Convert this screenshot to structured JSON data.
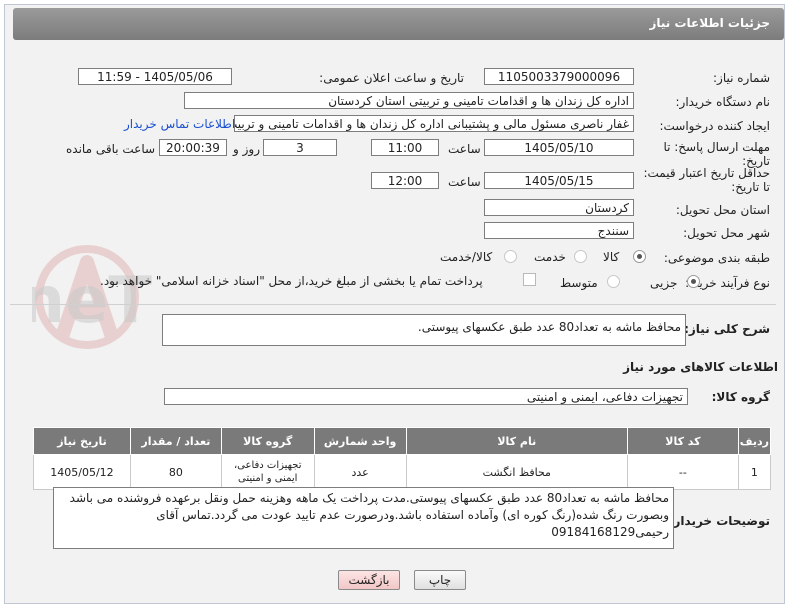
{
  "header": {
    "title": "جزئیات اطلاعات نیاز"
  },
  "form": {
    "need_number_label": "شماره نیاز:",
    "need_number": "1105003379000096",
    "announce_label": "تاریخ و ساعت اعلان عمومی:",
    "announce_value": "1405/05/06 - 11:59",
    "buyer_org_label": "نام دستگاه خریدار:",
    "buyer_org": "اداره کل زندان ها و اقدامات تامینی و تربیتی استان کردستان",
    "creator_label": "ایجاد کننده درخواست:",
    "creator": "غفار ناصری مسئول مالی و پشتیبانی اداره کل زندان ها و اقدامات تامینی و تربیت",
    "contact_link": "اطلاعات تماس خریدار",
    "deadline_label": "مهلت ارسال پاسخ: تا تاریخ:",
    "deadline_date": "1405/05/10",
    "deadline_time_label": "ساعت",
    "deadline_time": "11:00",
    "days_value": "3",
    "days_label": "روز و",
    "remaining_time": "20:00:39",
    "remaining_label": "ساعت باقی مانده",
    "validity_label": "حداقل تاریخ اعتبار قیمت: تا تاریخ:",
    "validity_date": "1405/05/15",
    "validity_time_label": "ساعت",
    "validity_time": "12:00",
    "province_label": "استان محل تحویل:",
    "province": "کردستان",
    "city_label": "شهر محل تحویل:",
    "city": "سنندج",
    "category_label": "طبقه بندی موضوعی:",
    "category_options": [
      "کالا",
      "خدمت",
      "کالا/خدمت"
    ],
    "process_label": "نوع فرآیند خرید :",
    "process_options": [
      "جزیی",
      "متوسط"
    ],
    "payment_note": "پرداخت تمام یا بخشی از مبلغ خرید،از محل \"اسناد خزانه اسلامی\" خواهد بود."
  },
  "summary": {
    "label": "شرح کلی نیاز:",
    "value": "محافظ ماشه به تعداد80 عدد طبق عکسهای پیوستی."
  },
  "goods_section": {
    "title": "اطلاعات کالاهای مورد نیاز",
    "group_label": "گروه کالا:",
    "group_value": "تجهیزات دفاعی، ایمنی و امنیتی"
  },
  "table": {
    "headers": [
      "ردیف",
      "کد کالا",
      "نام کالا",
      "واحد شمارش",
      "گروه کالا",
      "تعداد / مقدار",
      "تاریخ نیاز"
    ],
    "rows": [
      [
        "1",
        "--",
        "محافظ انگشت",
        "عدد",
        "تجهیزات دفاعی، ایمنی و امنیتی",
        "80",
        "1405/05/12"
      ]
    ]
  },
  "buyer_notes": {
    "label": "توضیحات خریدار:",
    "value": "محافظ ماشه به تعداد80 عدد طبق عکسهای پیوستی.مدت پرداخت یک ماهه وهزینه حمل ونقل برعهده فروشنده می باشد وبصورت رنگ شده(رنگ کوره ای) وآماده استفاده باشد.ودرصورت عدم تایید عودت می گردد.تماس آقای رحیمی09184168129"
  },
  "buttons": {
    "print": "چاپ",
    "back": "بازگشت"
  },
  "watermark": {
    "text": "AriaTender.neT"
  },
  "colors": {
    "accent": "#1a4fd1",
    "header_bg": "#8a8a8a",
    "table_header": "#7a7a7a",
    "back_button_bg": "#f7d4d4"
  }
}
